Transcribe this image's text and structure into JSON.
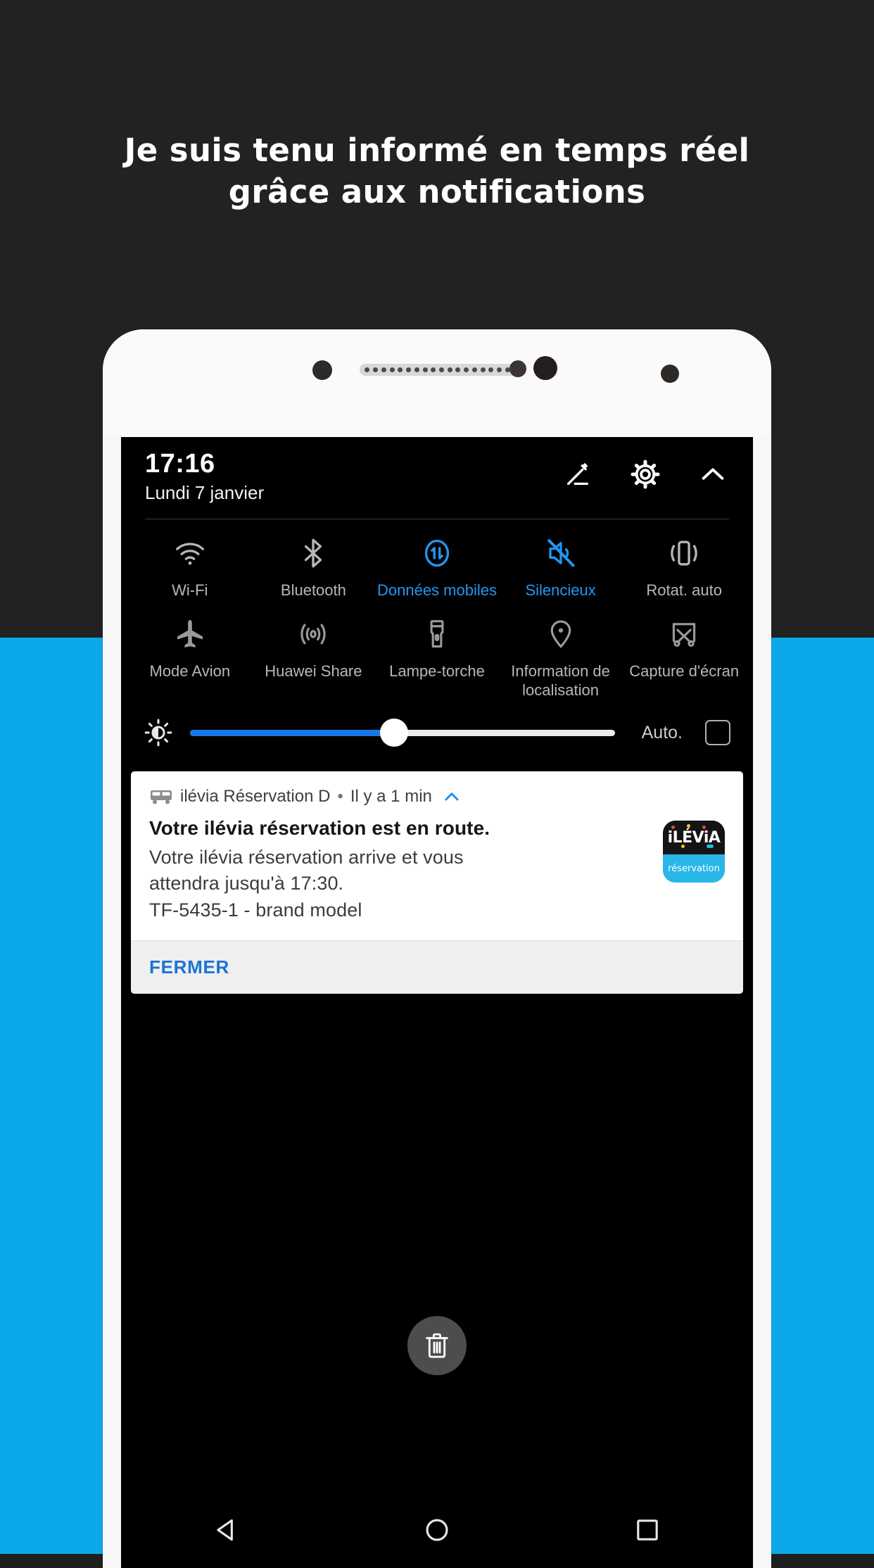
{
  "background": {
    "top_color": "#222222",
    "bottom_color": "#0aa8e8"
  },
  "headline": {
    "line1": "Je suis tenu informé en temps réel",
    "line2": "grâce aux notifications"
  },
  "phone": {
    "icons": {
      "camera": "camera-icon",
      "speaker": "speaker-grille-icon",
      "sensor": "proximity-sensor-icon"
    }
  },
  "status": {
    "time": "17:16",
    "date": "Lundi 7 janvier"
  },
  "header_icons": [
    {
      "name": "edit-icon",
      "label": "Modifier"
    },
    {
      "name": "gear-icon",
      "label": "Paramètres"
    },
    {
      "name": "chevron-up-icon",
      "label": "Réduire"
    }
  ],
  "quick_settings": {
    "row1": [
      {
        "label": "Wi-Fi",
        "icon": "wifi-icon",
        "active": false
      },
      {
        "label": "Bluetooth",
        "icon": "bluetooth-icon",
        "active": false
      },
      {
        "label": "Données mobiles",
        "icon": "mobile-data-icon",
        "active": true
      },
      {
        "label": "Silencieux",
        "icon": "mute-icon",
        "active": true
      },
      {
        "label": "Rotat. auto",
        "icon": "auto-rotate-icon",
        "active": false
      }
    ],
    "row2": [
      {
        "label": "Mode Avion",
        "icon": "airplane-icon",
        "active": false
      },
      {
        "label": "Huawei Share",
        "icon": "huawei-share-icon",
        "active": false
      },
      {
        "label": "Lampe-torche",
        "icon": "flashlight-icon",
        "active": false
      },
      {
        "label": "Information de localisation",
        "icon": "location-pin-icon",
        "active": false
      },
      {
        "label": "Capture d'écran",
        "icon": "screenshot-scissors-icon",
        "active": false
      }
    ],
    "active_color": "#2196f3",
    "inactive_color": "#b7b7b7"
  },
  "brightness": {
    "icon": "brightness-icon",
    "value_percent": 48,
    "auto_label": "Auto.",
    "auto_checked": false,
    "fill_color": "#1877e8"
  },
  "notification": {
    "icon": "bus-icon",
    "app_name": "ilévia Réservation D",
    "separator": "•",
    "time_ago": "Il y a 1 min",
    "expand_icon": "chevron-up-icon",
    "title": "Votre ilévia réservation est en route.",
    "body_line1": "Votre ilévia réservation arrive et vous",
    "body_line2": "attendra jusqu'à 17:30.",
    "body_line3": "TF-5435-1 - brand model",
    "action_label": "FERMER",
    "action_color": "#1a73d9",
    "app_icon": {
      "word": "iLÉViA",
      "subtitle": "réservation",
      "top_color": "#141414",
      "bottom_color": "#29b6e8"
    }
  },
  "clear_all": {
    "icon": "trash-icon",
    "label": "Effacer tout"
  },
  "navbar": [
    {
      "name": "back-button",
      "icon": "triangle-left-icon"
    },
    {
      "name": "home-button",
      "icon": "circle-icon"
    },
    {
      "name": "recents-button",
      "icon": "square-icon"
    }
  ]
}
